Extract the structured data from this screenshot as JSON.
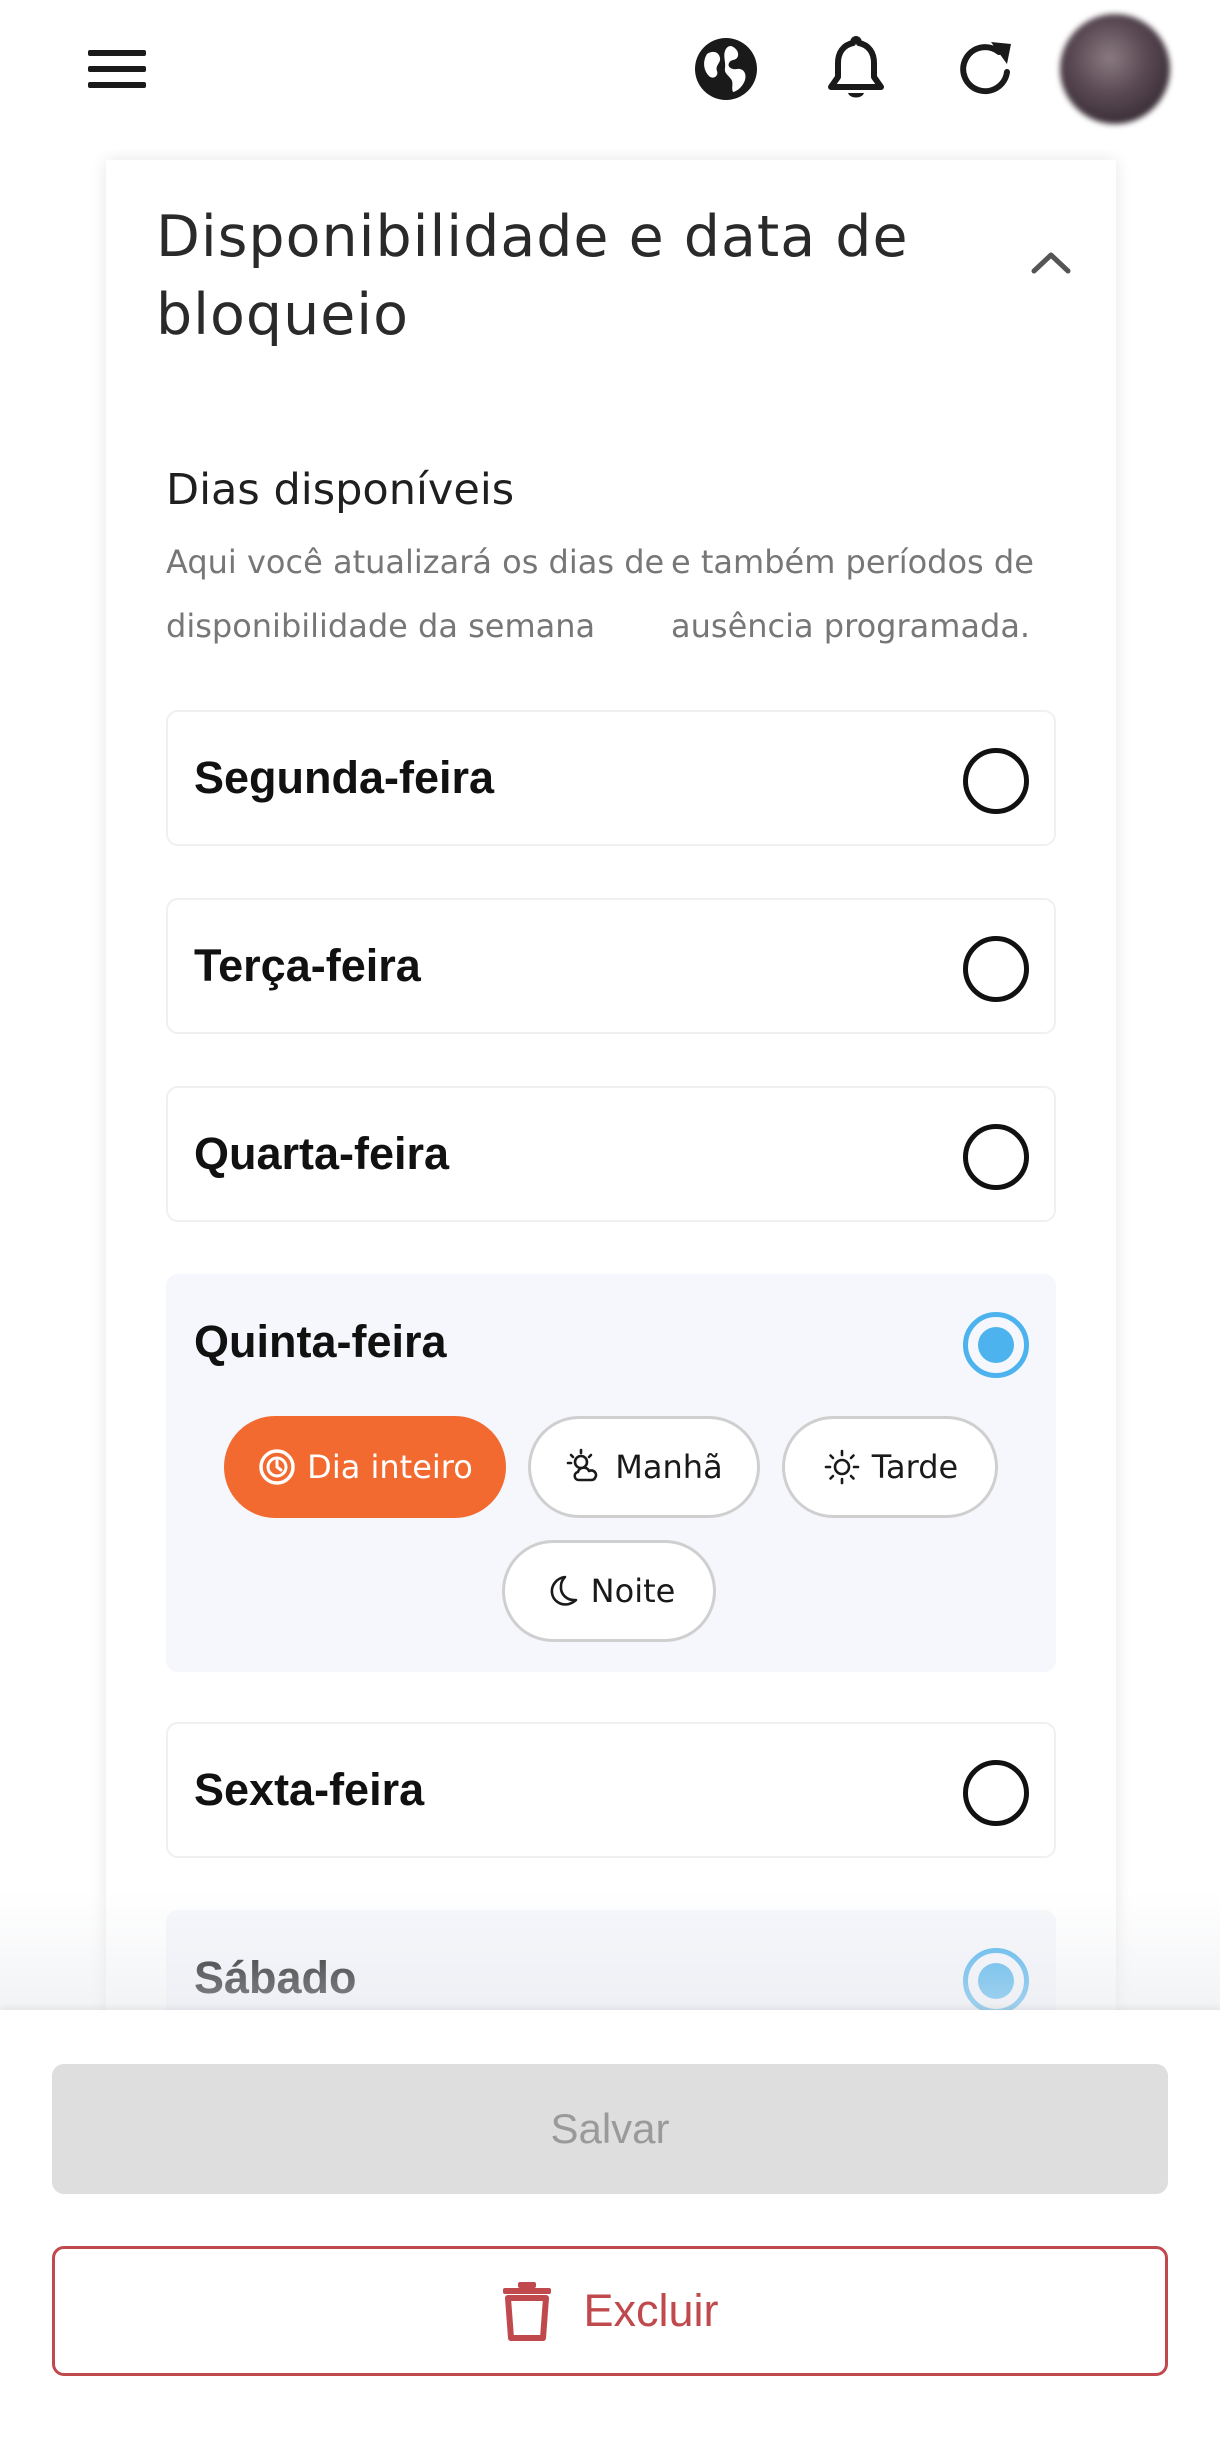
{
  "header": {
    "icons": [
      "menu-icon",
      "globe-icon",
      "bell-icon",
      "refresh-icon"
    ],
    "avatar": "avatar"
  },
  "card": {
    "title": "Disponibilidade e data de bloqueio",
    "section_title": "Dias disponíveis",
    "description_left": "Aqui você atualizará os dias de disponibilidade da semana",
    "description_right": "e também períodos de ausência programada."
  },
  "days": [
    {
      "name": "Segunda-feira",
      "selected": false
    },
    {
      "name": "Terça-feira",
      "selected": false
    },
    {
      "name": "Quarta-feira",
      "selected": false
    },
    {
      "name": "Quinta-feira",
      "selected": true
    },
    {
      "name": "Sexta-feira",
      "selected": false
    },
    {
      "name": "Sábado",
      "selected": true
    }
  ],
  "periods": {
    "full_day": "Dia inteiro",
    "morning": "Manhã",
    "afternoon": "Tarde",
    "night": "Noite",
    "active": "Dia inteiro"
  },
  "actions": {
    "save": "Salvar",
    "delete": "Excluir"
  },
  "colors": {
    "accent_orange": "#f26a30",
    "radio_blue": "#4db3ee",
    "danger": "#c0494d",
    "disabled_bg": "#dedede"
  }
}
